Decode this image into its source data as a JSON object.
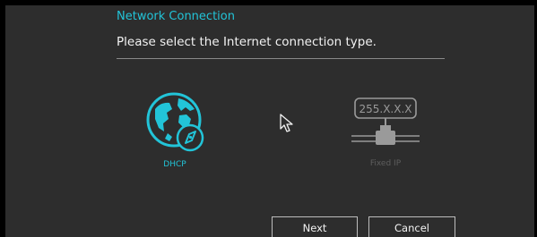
{
  "dialog": {
    "title": "Network Connection",
    "subtitle": "Please select the Internet connection type."
  },
  "options": [
    {
      "label": "DHCP",
      "icon": "globe-compass-icon",
      "selected": true
    },
    {
      "label": "Fixed IP",
      "icon": "ip-network-icon",
      "selected": false,
      "icon_text": "255.X.X.X"
    }
  ],
  "buttons": {
    "next_label": "Next",
    "cancel_label": "Cancel"
  },
  "colors": {
    "accent": "#22c4d8",
    "panel_background": "#2d2d2d",
    "text": "#f2f2f2",
    "disabled": "#5e5e5e"
  }
}
